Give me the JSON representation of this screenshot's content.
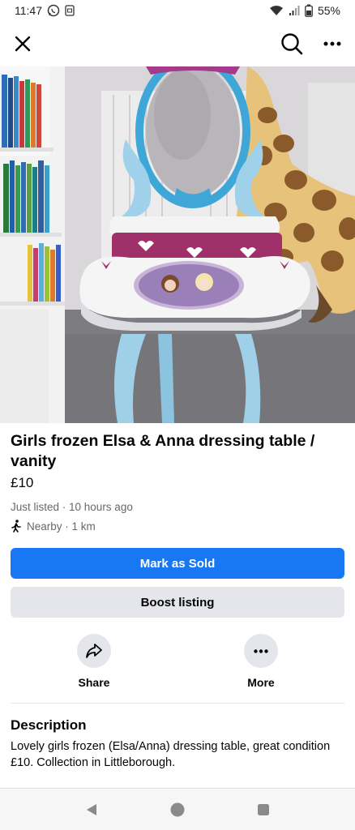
{
  "status_bar": {
    "time": "11:47",
    "battery": "55%",
    "icons": [
      "whatsapp-icon",
      "notification-icon",
      "wifi-icon",
      "signal-icon",
      "battery-icon"
    ]
  },
  "top_bar": {
    "icons": [
      "close-icon",
      "search-icon",
      "more-icon"
    ]
  },
  "listing": {
    "title": "Girls frozen Elsa & Anna dressing table / vanity",
    "price": "£10",
    "listed": "Just listed · 10 hours ago",
    "location": "Nearby · 1 km"
  },
  "buttons": {
    "mark_sold": "Mark as Sold",
    "boost": "Boost listing"
  },
  "actions": {
    "share": "Share",
    "more": "More"
  },
  "description": {
    "heading": "Description",
    "body": "Lovely girls frozen (Elsa/Anna) dressing table, great condition £10. Collection in Littleborough."
  },
  "colors": {
    "primary": "#1877f2",
    "secondary_bg": "#e4e6eb",
    "meta_text": "#65676b"
  },
  "nav_bar": {
    "icons": [
      "back-icon",
      "home-icon",
      "recents-icon"
    ]
  }
}
